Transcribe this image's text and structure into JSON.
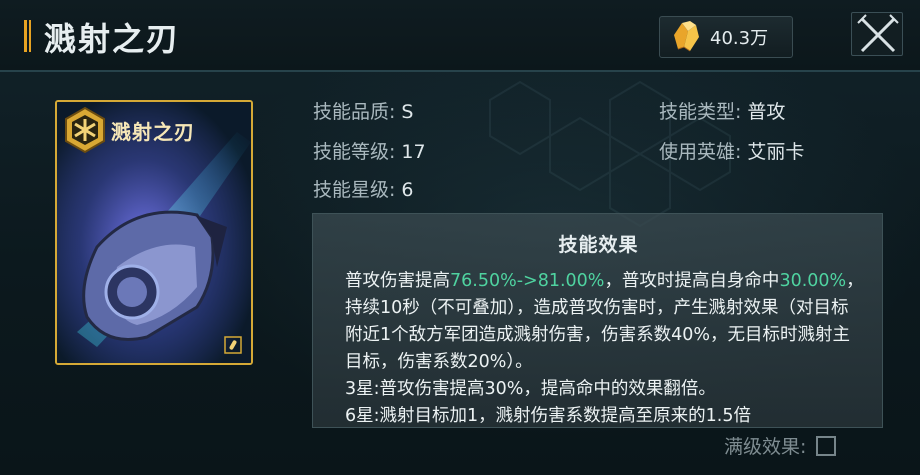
{
  "header": {
    "title": "溅射之刃",
    "currency_amount": "40.3万",
    "currency_icon": "crystal-icon",
    "close_icon": "close-icon"
  },
  "card": {
    "name": "溅射之刃",
    "badge_icon": "hex-emblem-icon",
    "corner_icon": "bullet-icon"
  },
  "info": {
    "quality_label": "技能品质:",
    "quality_value": "S",
    "level_label": "技能等级:",
    "level_value": "17",
    "star_label": "技能星级:",
    "star_value": "6",
    "type_label": "技能类型:",
    "type_value": "普攻",
    "hero_label": "使用英雄:",
    "hero_value": "艾丽卡"
  },
  "effect": {
    "title": "技能效果",
    "p1_a": "普攻伤害提高",
    "p1_hl": "76.50%->81.00%",
    "p1_b": "，普攻时提高自身命中",
    "p2_hl": "30.00%",
    "p2_b": "，持续10秒（不可叠加），造成普攻伤害时，产生溅射效果（对目标附近1个敌方军团造成溅射伤害，伤害系数40%，无目标时溅射主目标，伤害系数20%）。",
    "line3": "3星:普攻伤害提高30%，提高命中的效果翻倍。",
    "line4": "6星:溅射目标加1，溅射伤害系数提高至原来的1.5倍"
  },
  "footer": {
    "max_label": "满级效果:"
  },
  "colors": {
    "highlight": "#4fd3a0",
    "card_border": "#d5a936",
    "accent": "#e7a323"
  }
}
